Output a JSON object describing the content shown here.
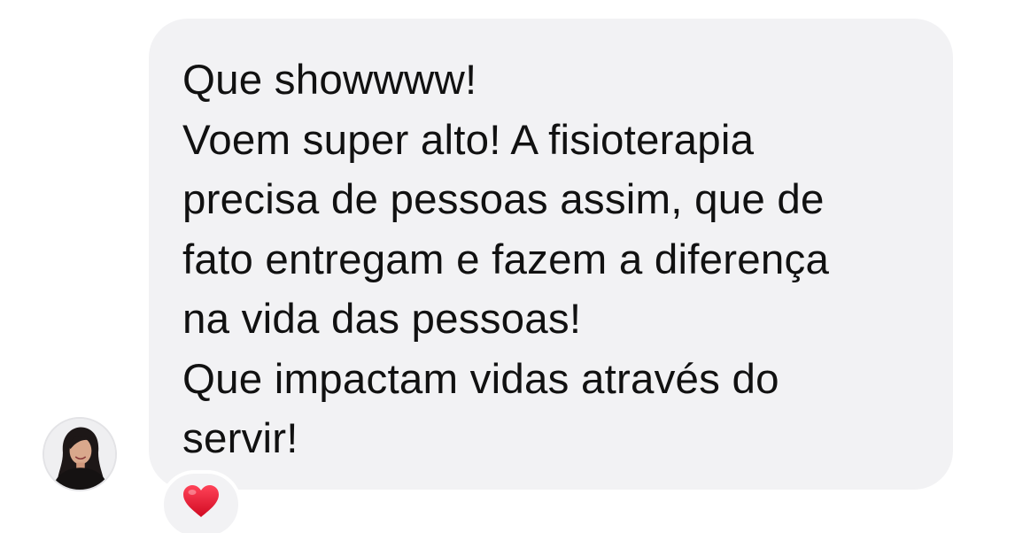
{
  "message": {
    "lines": [
      "Que showwww!",
      "Voem super alto! A fisioterapia",
      "precisa de pessoas assim, que de",
      "fato entregam e fazem a diferença",
      "na vida das pessoas!",
      "Que impactam vidas através do",
      "servir!"
    ],
    "bubble_color": "#f2f2f4",
    "text_color": "#111111"
  },
  "sender": {
    "avatar_icon": "profile-photo"
  },
  "reaction": {
    "icon": "red-heart-icon",
    "color": "#e0122c"
  }
}
